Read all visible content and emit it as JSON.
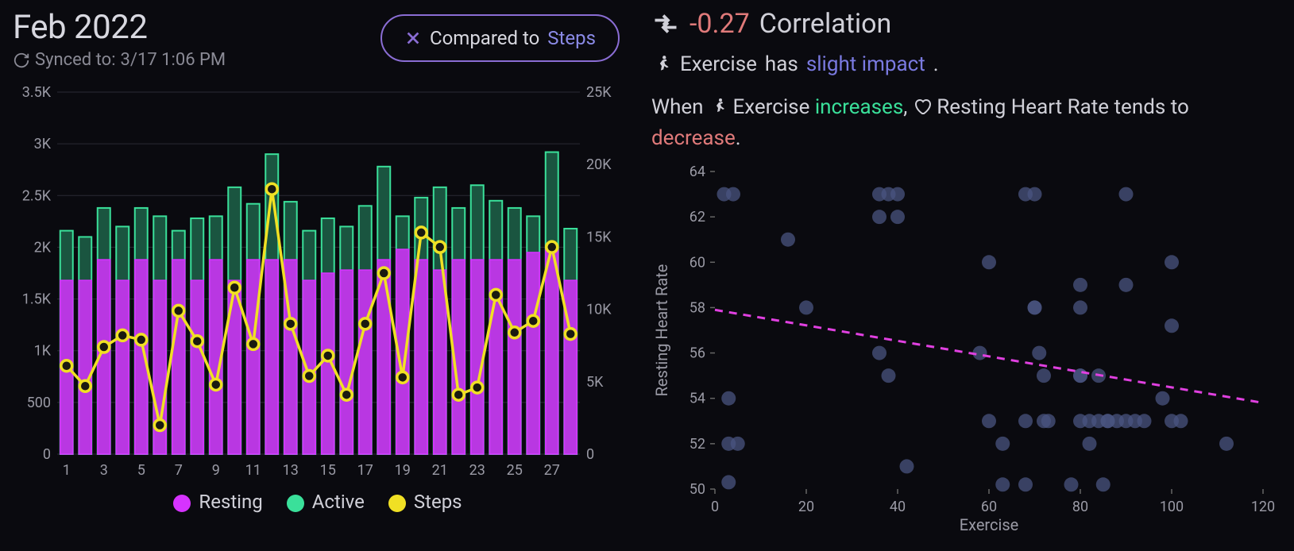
{
  "header": {
    "title": "Feb 2022",
    "synced_prefix": "Synced to:",
    "synced_value": "3/17 1:06 PM",
    "compare_prefix": "Compared to",
    "compare_target": "Steps"
  },
  "legend": {
    "resting": "Resting",
    "active": "Active",
    "steps": "Steps"
  },
  "colors": {
    "resting": "#d633ff",
    "active": "#3ae09a",
    "steps": "#f0e024",
    "grid": "#2a2a35",
    "axis": "#9a9aa5",
    "trend": "#e040e0",
    "scatter_pt": "#4a5480",
    "corr_neg": "#e07a7a",
    "inc": "#3ae09a",
    "impact": "#7a7ae0"
  },
  "correlation": {
    "value": "-0.27",
    "label": "Correlation",
    "impact_subject": "Exercise",
    "impact_text_prefix": "has",
    "impact_phrase": "slight impact",
    "sentence_when": "When",
    "sentence_subj": "Exercise",
    "sentence_verb": "increases",
    "sentence_obj": "Resting Heart Rate",
    "sentence_tends": "tends to",
    "sentence_dir": "decrease"
  },
  "chart_data": [
    {
      "id": "daily",
      "title": "Feb 2022 daily resting/active/steps",
      "type": "bar",
      "x": [
        1,
        2,
        3,
        4,
        5,
        6,
        7,
        8,
        9,
        10,
        11,
        12,
        13,
        14,
        15,
        16,
        17,
        18,
        19,
        20,
        21,
        22,
        23,
        24,
        25,
        26,
        27,
        28
      ],
      "x_ticks": [
        1,
        3,
        5,
        7,
        9,
        11,
        13,
        15,
        17,
        19,
        21,
        23,
        25,
        27
      ],
      "y_left": {
        "label": "",
        "min": 0,
        "max": 3500,
        "ticks": [
          0,
          500,
          1000,
          1500,
          2000,
          2500,
          3000,
          3500
        ],
        "tick_labels": [
          "0",
          "500",
          "1K",
          "1.5K",
          "2K",
          "2.5K",
          "3K",
          "3.5K"
        ]
      },
      "y_right": {
        "label": "",
        "min": 0,
        "max": 25000,
        "ticks": [
          0,
          5000,
          10000,
          15000,
          20000,
          25000
        ],
        "tick_labels": [
          "0",
          "5K",
          "10K",
          "15K",
          "20K",
          "25K"
        ]
      },
      "series": [
        {
          "name": "Resting",
          "axis": "left",
          "type": "bar",
          "values": [
            1680,
            1680,
            1880,
            1680,
            1880,
            1680,
            1880,
            1680,
            1880,
            1680,
            1880,
            1880,
            1880,
            1680,
            1750,
            1780,
            1780,
            1880,
            1980,
            1880,
            1780,
            1880,
            1880,
            1880,
            1880,
            1950,
            1980,
            1680
          ]
        },
        {
          "name": "Active",
          "axis": "left",
          "type": "bar_stack",
          "values": [
            2160,
            2100,
            2380,
            2200,
            2380,
            2300,
            2160,
            2280,
            2300,
            2580,
            2420,
            2900,
            2440,
            2160,
            2280,
            2200,
            2400,
            2780,
            2300,
            2480,
            2580,
            2380,
            2600,
            2450,
            2380,
            2300,
            2920,
            2180
          ]
        },
        {
          "name": "Steps",
          "axis": "right",
          "type": "line",
          "values": [
            6100,
            4700,
            7400,
            8200,
            7900,
            2000,
            9900,
            7800,
            4800,
            11500,
            7600,
            18300,
            9000,
            5400,
            6800,
            4100,
            9000,
            12500,
            5300,
            15300,
            14300,
            4100,
            4600,
            11000,
            8400,
            9200,
            14300,
            8300
          ]
        }
      ]
    },
    {
      "id": "scatter",
      "type": "scatter",
      "xlabel": "Exercise",
      "ylabel": "Resting Heart Rate",
      "xlim": [
        0,
        120
      ],
      "x_ticks": [
        0,
        20,
        40,
        60,
        80,
        100,
        120
      ],
      "ylim": [
        50,
        64
      ],
      "y_ticks": [
        50,
        52,
        54,
        56,
        58,
        60,
        62,
        64
      ],
      "trend": {
        "x1": 0,
        "y1": 57.9,
        "x2": 120,
        "y2": 53.8
      },
      "points": [
        [
          2,
          63
        ],
        [
          4,
          63
        ],
        [
          3,
          54
        ],
        [
          3,
          52
        ],
        [
          5,
          52
        ],
        [
          3,
          50.3
        ],
        [
          16,
          61
        ],
        [
          20,
          58
        ],
        [
          36,
          63
        ],
        [
          38,
          63
        ],
        [
          40,
          63
        ],
        [
          40,
          62
        ],
        [
          36,
          62
        ],
        [
          36,
          56
        ],
        [
          38,
          55
        ],
        [
          42,
          51
        ],
        [
          60,
          60
        ],
        [
          58,
          56
        ],
        [
          60,
          53
        ],
        [
          63,
          52
        ],
        [
          63,
          50.2
        ],
        [
          68,
          63
        ],
        [
          70,
          63
        ],
        [
          70,
          58
        ],
        [
          70,
          58
        ],
        [
          71,
          56
        ],
        [
          72,
          55
        ],
        [
          72,
          53
        ],
        [
          68,
          53
        ],
        [
          73,
          53
        ],
        [
          68,
          50.2
        ],
        [
          80,
          59
        ],
        [
          80,
          58
        ],
        [
          80,
          55
        ],
        [
          80,
          55
        ],
        [
          80,
          53
        ],
        [
          82,
          53
        ],
        [
          82,
          52
        ],
        [
          78,
          50.2
        ],
        [
          84,
          55
        ],
        [
          84,
          53
        ],
        [
          86,
          53
        ],
        [
          86,
          53
        ],
        [
          85,
          50.2
        ],
        [
          90,
          63
        ],
        [
          90,
          59
        ],
        [
          88,
          53
        ],
        [
          90,
          53
        ],
        [
          92,
          53
        ],
        [
          94,
          53
        ],
        [
          98,
          54
        ],
        [
          100,
          60
        ],
        [
          100,
          53
        ],
        [
          102,
          53
        ],
        [
          100,
          57.2
        ],
        [
          112,
          52
        ]
      ]
    }
  ]
}
